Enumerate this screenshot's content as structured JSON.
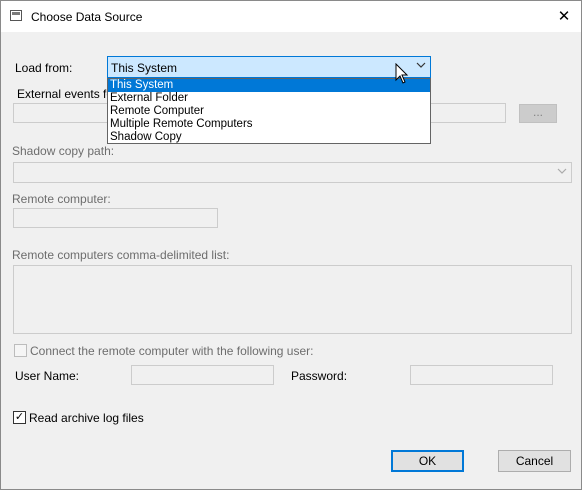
{
  "window": {
    "title": "Choose Data Source",
    "close_icon": "close-icon"
  },
  "load_from": {
    "label": "Load from:",
    "selected": "This System",
    "options": [
      "This System",
      "External Folder",
      "Remote Computer",
      "Multiple Remote Computers",
      "Shadow Copy"
    ]
  },
  "external_events": {
    "label": "External events fo",
    "browse_label": "..."
  },
  "shadow_copy": {
    "label": "Shadow copy path:"
  },
  "remote_computer": {
    "label": "Remote computer:"
  },
  "remote_list": {
    "label": "Remote computers comma-delimited list:"
  },
  "connect_user": {
    "label": "Connect the remote computer with the following user:",
    "checked": false
  },
  "credentials": {
    "user_label": "User Name:",
    "password_label": "Password:"
  },
  "archive": {
    "label": "Read archive log files",
    "checked": true,
    "check_mark": "✓"
  },
  "buttons": {
    "ok": "OK",
    "cancel": "Cancel"
  }
}
